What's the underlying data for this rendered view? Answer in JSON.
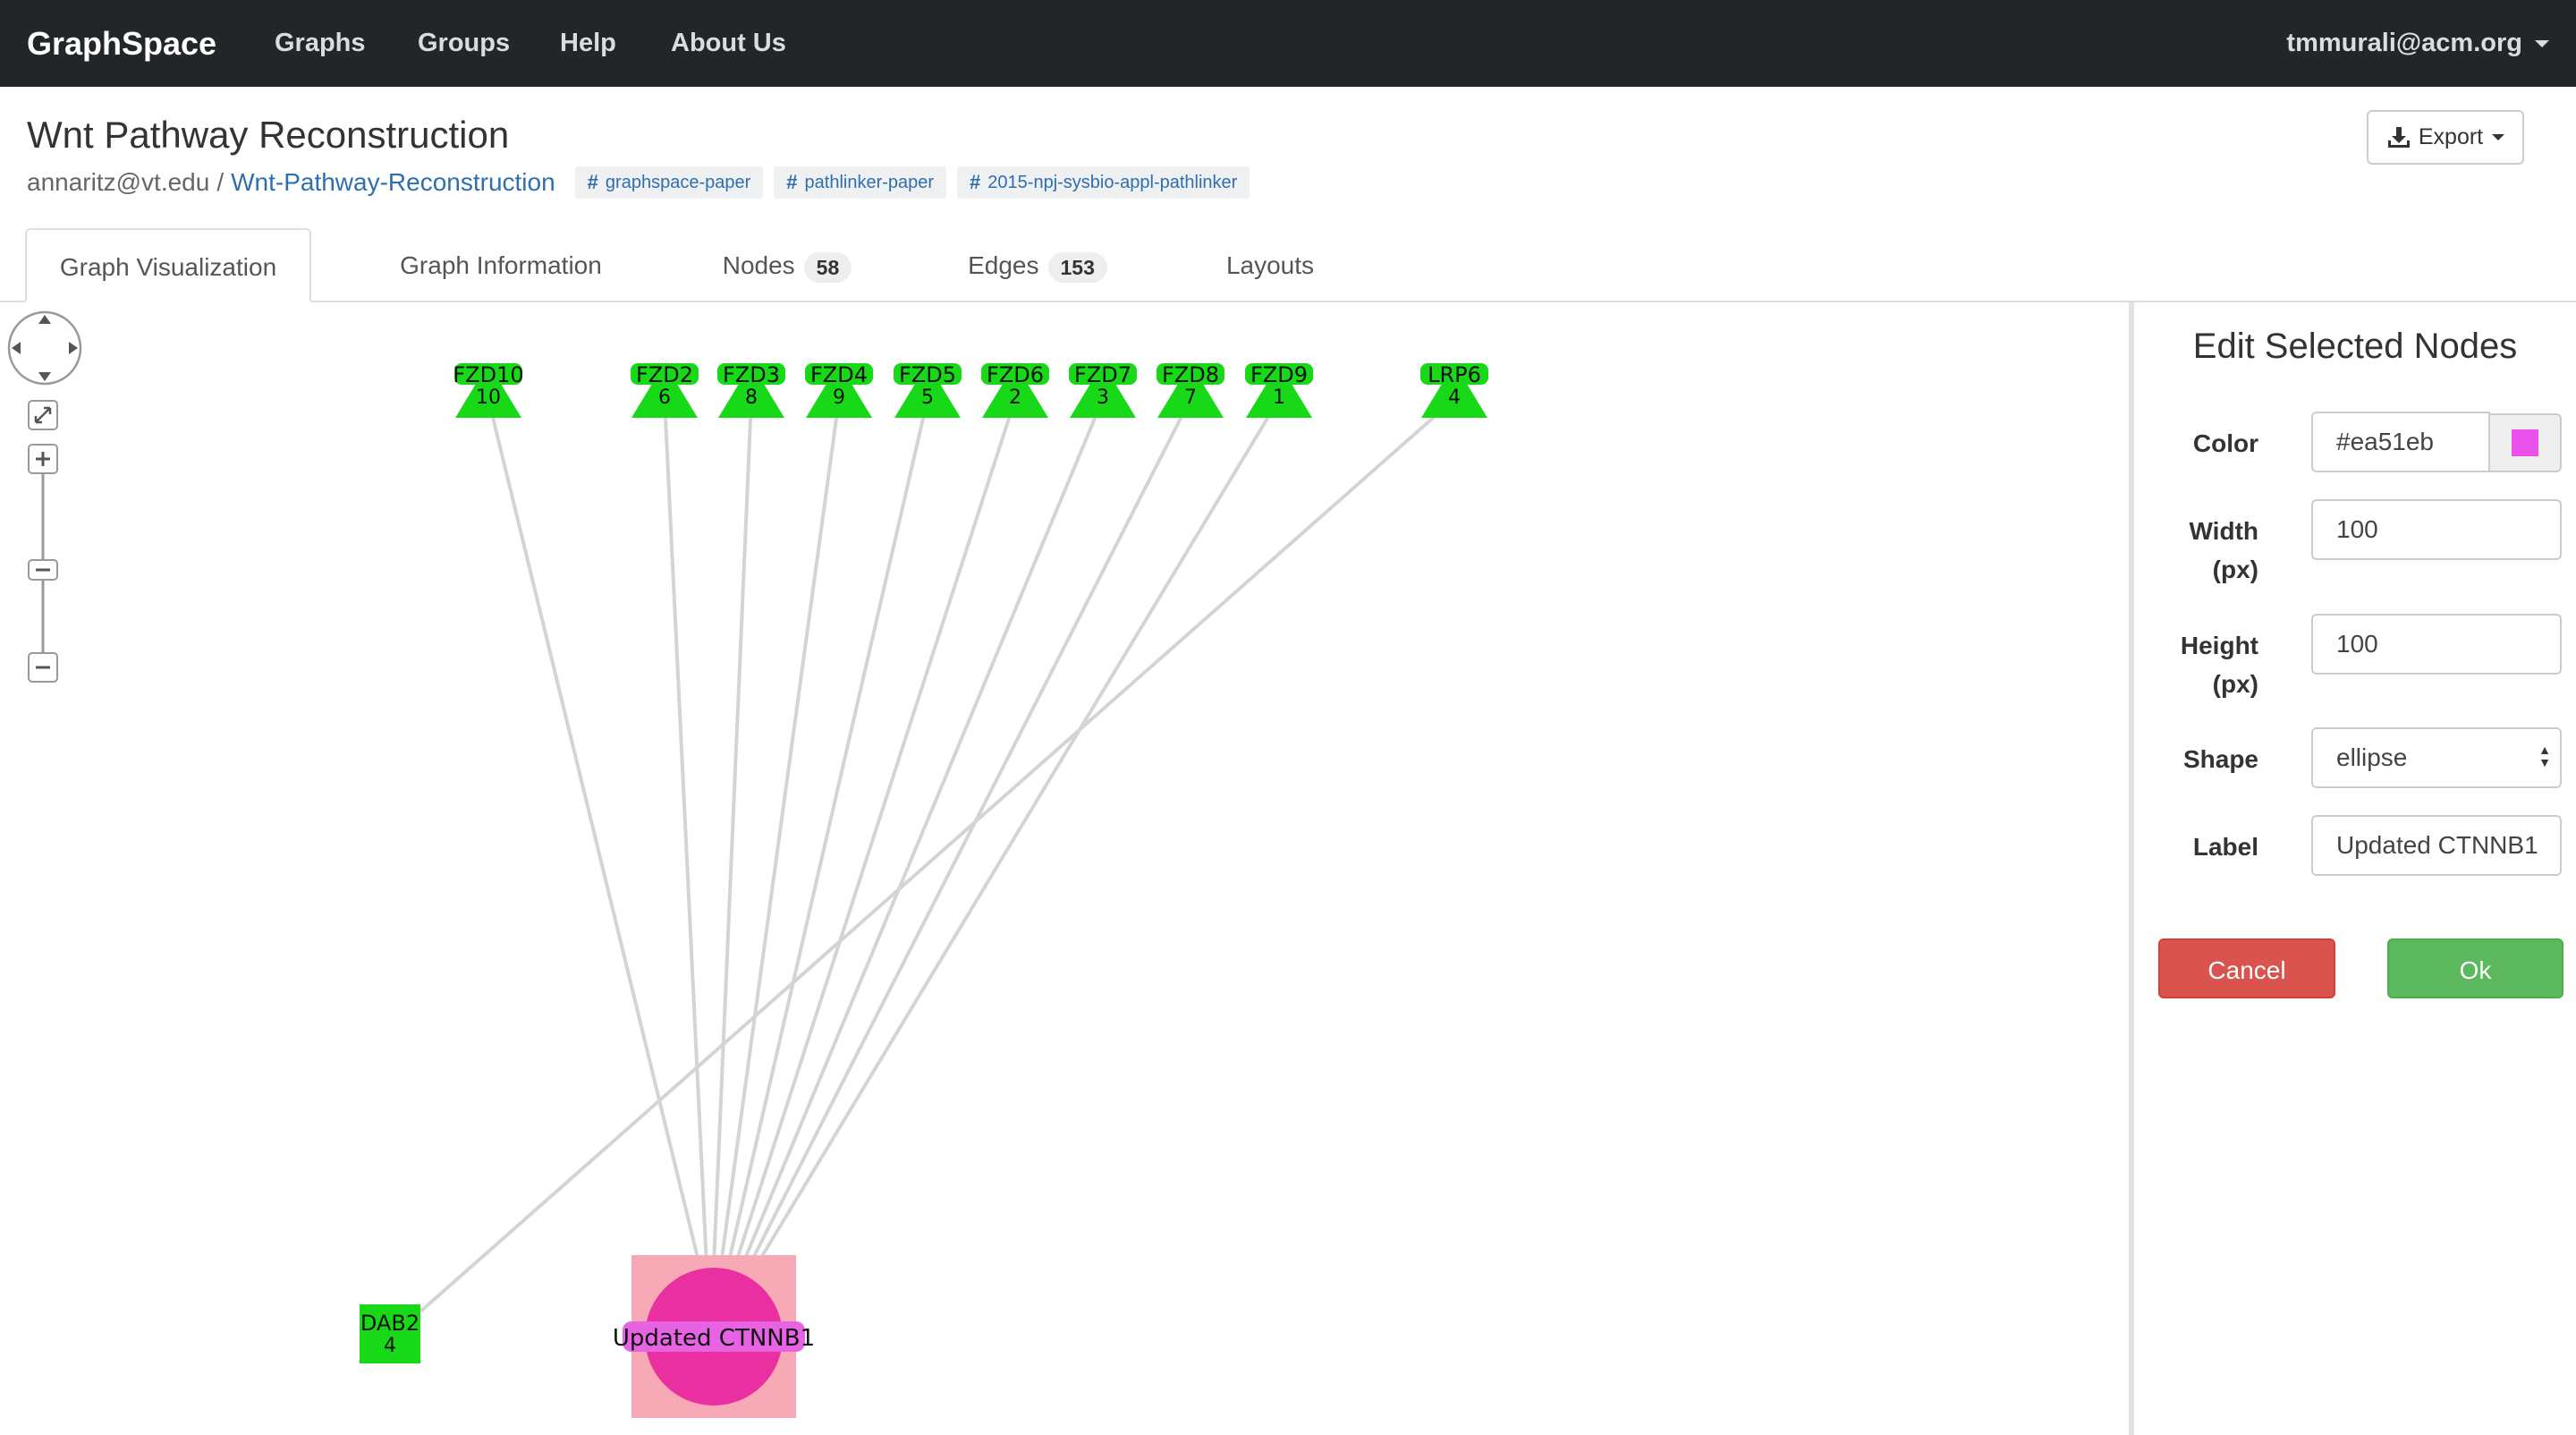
{
  "navbar": {
    "brand": "GraphSpace",
    "links": [
      "Graphs",
      "Groups",
      "Help",
      "About Us"
    ],
    "user": "tmmurali@acm.org"
  },
  "header": {
    "title": "Wnt Pathway Reconstruction",
    "owner": "annaritz@vt.edu",
    "separator": "/",
    "graph_link": "Wnt-Pathway-Reconstruction",
    "tags": [
      "graphspace-paper",
      "pathlinker-paper",
      "2015-npj-sysbio-appl-pathlinker"
    ],
    "export_label": "Export"
  },
  "tabs": [
    {
      "label": "Graph Visualization",
      "active": true
    },
    {
      "label": "Graph Information"
    },
    {
      "label": "Nodes",
      "count": "58"
    },
    {
      "label": "Edges",
      "count": "153"
    },
    {
      "label": "Layouts"
    }
  ],
  "graph": {
    "nodes": [
      {
        "id": "fzd10",
        "name": "FZD10",
        "rank": "10",
        "shape": "triangle",
        "color": "#18d918"
      },
      {
        "id": "fzd2",
        "name": "FZD2",
        "rank": "6",
        "shape": "triangle",
        "color": "#18d918"
      },
      {
        "id": "fzd3",
        "name": "FZD3",
        "rank": "8",
        "shape": "triangle",
        "color": "#18d918"
      },
      {
        "id": "fzd4",
        "name": "FZD4",
        "rank": "9",
        "shape": "triangle",
        "color": "#18d918"
      },
      {
        "id": "fzd5",
        "name": "FZD5",
        "rank": "5",
        "shape": "triangle",
        "color": "#18d918"
      },
      {
        "id": "fzd6",
        "name": "FZD6",
        "rank": "2",
        "shape": "triangle",
        "color": "#18d918"
      },
      {
        "id": "fzd7",
        "name": "FZD7",
        "rank": "3",
        "shape": "triangle",
        "color": "#18d918"
      },
      {
        "id": "fzd8",
        "name": "FZD8",
        "rank": "7",
        "shape": "triangle",
        "color": "#18d918"
      },
      {
        "id": "fzd9",
        "name": "FZD9",
        "rank": "1",
        "shape": "triangle",
        "color": "#18d918"
      },
      {
        "id": "lrp6",
        "name": "LRP6",
        "rank": "4",
        "shape": "triangle",
        "color": "#18d918"
      },
      {
        "id": "dab2",
        "name": "DAB2",
        "rank": "4",
        "shape": "square",
        "color": "#18d918"
      },
      {
        "id": "ctnnb1",
        "name": "Updated CTNNB1",
        "shape": "ellipse",
        "color": "#ea2fa0",
        "selected": true
      }
    ],
    "edges": [
      [
        "fzd10",
        "ctnnb1"
      ],
      [
        "fzd2",
        "ctnnb1"
      ],
      [
        "fzd3",
        "ctnnb1"
      ],
      [
        "fzd4",
        "ctnnb1"
      ],
      [
        "fzd5",
        "ctnnb1"
      ],
      [
        "fzd6",
        "ctnnb1"
      ],
      [
        "fzd7",
        "ctnnb1"
      ],
      [
        "fzd8",
        "ctnnb1"
      ],
      [
        "fzd9",
        "ctnnb1"
      ],
      [
        "lrp6",
        "dab2"
      ]
    ],
    "edge_color": "#d4d4d4"
  },
  "panel": {
    "title": "Edit Selected Nodes",
    "color_label": "Color",
    "color_value": "#ea51eb",
    "width_label_1": "Width",
    "width_label_2": "(px)",
    "width_value": "100",
    "height_label_1": "Height",
    "height_label_2": "(px)",
    "height_value": "100",
    "shape_label": "Shape",
    "shape_value": "ellipse",
    "label_label": "Label",
    "label_value": "Updated CTNNB1",
    "cancel_label": "Cancel",
    "ok_label": "Ok"
  },
  "colors": {
    "navbar_bg": "#222629",
    "link": "#2f6fae",
    "cancel": "#d9534f",
    "ok": "#5cb85c",
    "node_green": "#18d918",
    "selected_node": "#ea2fa0"
  }
}
